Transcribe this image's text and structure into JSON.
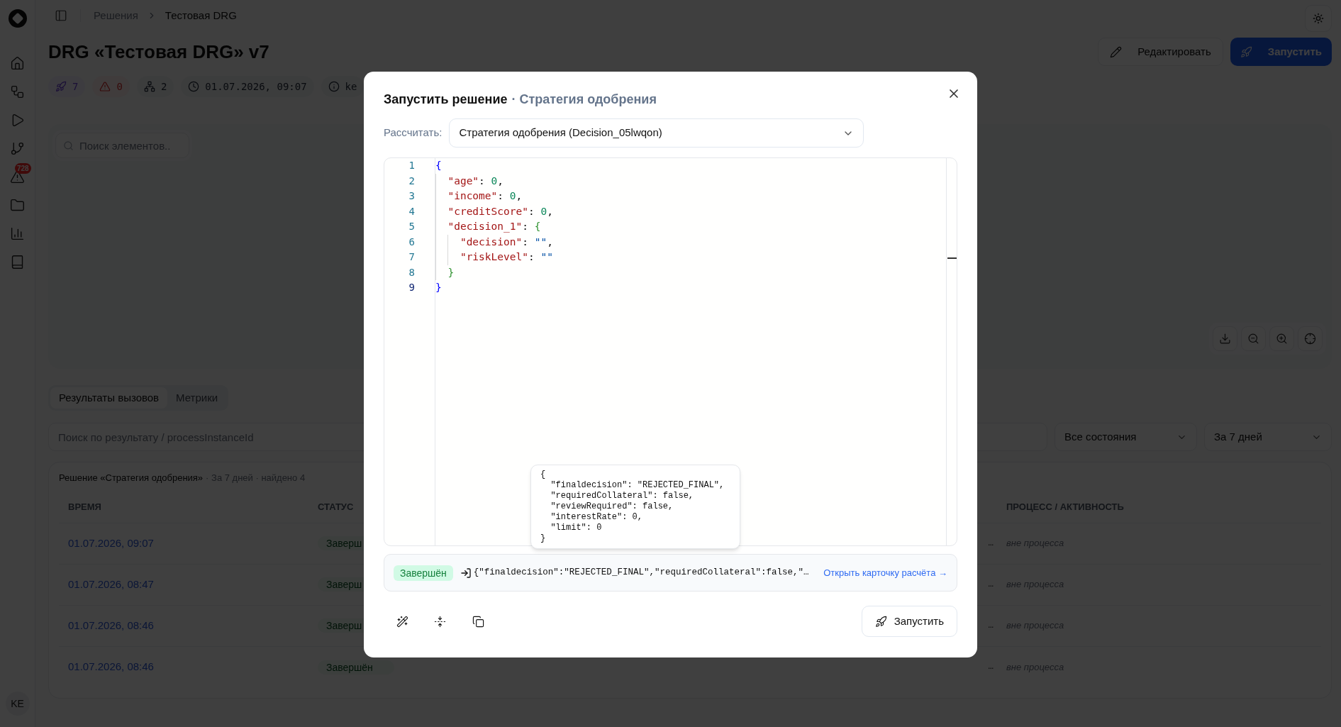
{
  "sidebar": {
    "alert_badge": "728",
    "avatar": "KE"
  },
  "breadcrumbs": [
    "Решения",
    "Тестовая DRG"
  ],
  "page": {
    "title": "DRG «Тестовая DRG» v7",
    "edit_label": "Редактировать",
    "run_label": "Запустить"
  },
  "chips": [
    {
      "kind": "runs",
      "text": "7"
    },
    {
      "kind": "errors",
      "text": "0"
    },
    {
      "kind": "nodes",
      "text": "2"
    },
    {
      "kind": "time",
      "text": "01.07.2026, 09:07"
    },
    {
      "kind": "info",
      "text": "ke"
    }
  ],
  "canvas": {
    "search_placeholder": "Поиск элементов.."
  },
  "tabs": [
    {
      "label": "Результаты вызовов",
      "selected": true
    },
    {
      "label": "Метрики",
      "selected": false
    }
  ],
  "filters": {
    "search_placeholder": "Поиск по результату / processInstanceId",
    "state": "Все состояния",
    "period": "За 7 дней"
  },
  "results": {
    "title": "Решение «Стратегия одобрения»",
    "meta": "· За 7 дней · найдено 4",
    "columns": {
      "time": "ВРЕМЯ",
      "status": "СТАТУС",
      "process": "ПРОЦЕСС / АКТИВНОСТЬ"
    },
    "rows": [
      {
        "time": "01.07.2026, 09:07",
        "status": "Заверш",
        "result": "…",
        "process": "вне процесса"
      },
      {
        "time": "01.07.2026, 08:47",
        "status": "Заверш",
        "result": "…",
        "process": "вне процесса"
      },
      {
        "time": "01.07.2026, 08:46",
        "status": "Заверш",
        "result": "…",
        "process": "вне процесса"
      },
      {
        "time": "01.07.2026, 08:46",
        "status": "Завершён",
        "result": "…",
        "process": "вне процесса"
      }
    ]
  },
  "modal": {
    "title": "Запустить решение",
    "subtitle": "· Стратегия одобрения",
    "calc_label": "Рассчитать:",
    "calc_value": "Стратегия одобрения (Decision_05lwqon)",
    "editor": [
      {
        "number": "1",
        "code": "{",
        "active": false
      },
      {
        "number": "2",
        "code": "  \"age\": 0,",
        "active": false
      },
      {
        "number": "3",
        "code": "  \"income\": 0,",
        "active": false
      },
      {
        "number": "4",
        "code": "  \"creditScore\": 0,",
        "active": false
      },
      {
        "number": "5",
        "code": "  \"decision_1\": {",
        "active": false
      },
      {
        "number": "6",
        "code": "    \"decision\": \"\",",
        "active": false
      },
      {
        "number": "7",
        "code": "    \"riskLevel\": \"\"",
        "active": false
      },
      {
        "number": "8",
        "code": "  }",
        "active": false
      },
      {
        "number": "9",
        "code": "}",
        "active": true
      }
    ],
    "tooltip": "{\n  \"finaldecision\": \"REJECTED_FINAL\",\n  \"requiredCollateral\": false,\n  \"reviewRequired\": false,\n  \"interestRate\": 0,\n  \"limit\": 0\n}",
    "result": {
      "status": "Завершён",
      "output": "{\"finaldecision\":\"REJECTED_FINAL\",\"requiredCollateral\":false,\"…",
      "link": "Открыть карточку расчёта →"
    },
    "run_label": "Запустить"
  }
}
